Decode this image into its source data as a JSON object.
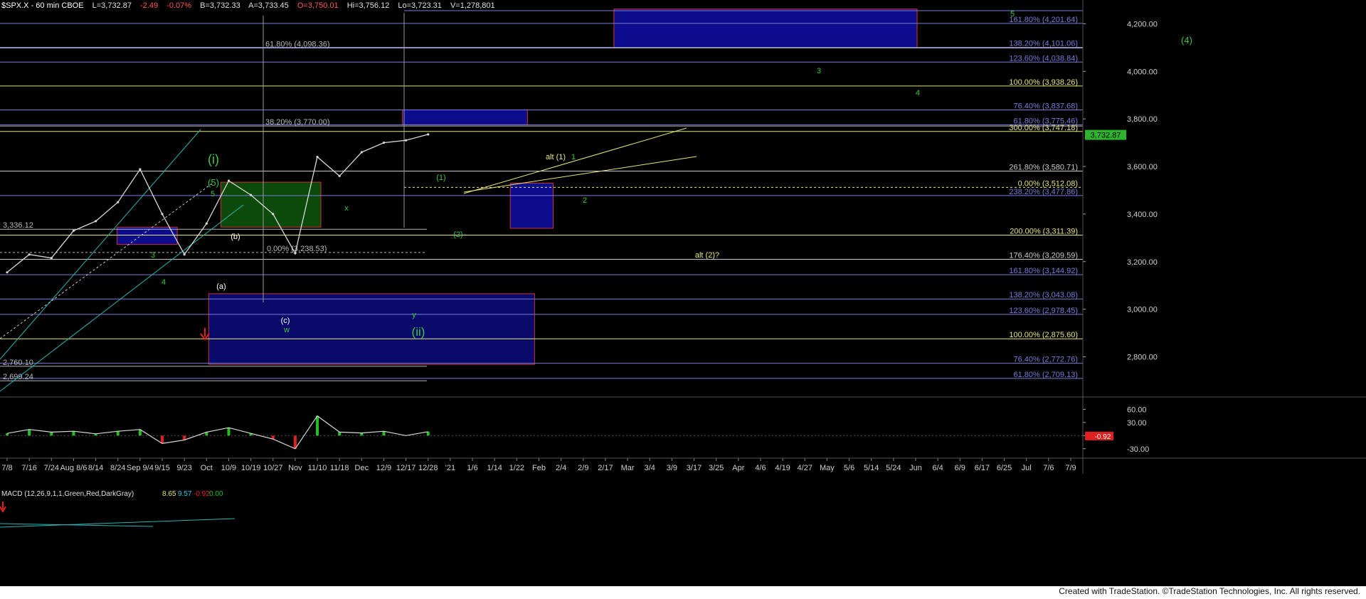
{
  "header": {
    "symbol": "$SPX.X - 60 min  CBOE",
    "last": "L=3,732.87",
    "change": "-2.49",
    "change_pct": "-0.07%",
    "bid": "B=3,732.33",
    "ask": "A=3,733.45",
    "open": "O=3,750.01",
    "high": "Hi=3,756.12",
    "low": "Lo=3,723.31",
    "volume": "V=1,278,801"
  },
  "price_scale": {
    "ticks": [
      {
        "v": 4200,
        "label": "4,200.00"
      },
      {
        "v": 4000,
        "label": "4,000.00"
      },
      {
        "v": 3800,
        "label": "3,800.00"
      },
      {
        "v": 3600,
        "label": "3,600.00"
      },
      {
        "v": 3400,
        "label": "3,400.00"
      },
      {
        "v": 3200,
        "label": "3,200.00"
      },
      {
        "v": 3000,
        "label": "3,000.00"
      },
      {
        "v": 2800,
        "label": "2,800.00"
      }
    ],
    "last_price": "3,732.87",
    "last_color": "#2db32d"
  },
  "macd_scale": {
    "ticks": [
      {
        "v": 60,
        "label": "60.00"
      },
      {
        "v": 30,
        "label": "30.00"
      },
      {
        "v": 0,
        "label": ""
      },
      {
        "v": -30,
        "label": "-30.00"
      }
    ],
    "last": "-0.92",
    "last_color": "#e02020"
  },
  "macd_legend": {
    "name": "MACD (12,26,9,1,1,Green,Red,DarkGray)",
    "values": [
      "8.65",
      "9.57",
      "-0.92",
      "0.00"
    ]
  },
  "time_axis": [
    "7/8",
    "7/16",
    "7/24",
    "Aug 8/6",
    "8/14",
    "8/24",
    "Sep 9/4",
    "9/15",
    "9/23",
    "Oct",
    "10/9",
    "10/19",
    "10/27",
    "Nov",
    "11/10",
    "11/18",
    "Dec",
    "12/9",
    "12/17",
    "12/28",
    "'21",
    "1/6",
    "1/14",
    "1/22",
    "Feb",
    "2/4",
    "2/9",
    "2/17",
    "Mar",
    "3/4",
    "3/9",
    "3/17",
    "3/25",
    "Apr",
    "4/6",
    "4/19",
    "4/27",
    "May",
    "5/6",
    "5/14",
    "5/24",
    "Jun",
    "6/4",
    "6/9",
    "6/17",
    "6/25",
    "Jul",
    "7/6",
    "7/9"
  ],
  "fib_levels": [
    {
      "text": "161.80% (4,201.64)",
      "v": 4201.64,
      "color": "#7b7bd8"
    },
    {
      "text": "138.20% (4,101.06)",
      "v": 4101.06,
      "color": "#7b7bd8"
    },
    {
      "text": "123.60% (4,038.84)",
      "v": 4038.84,
      "color": "#7b7bd8"
    },
    {
      "text": "100.00% (3,938.26)",
      "v": 3938.26,
      "color": "#e6e67a"
    },
    {
      "text": "76.40% (3,837.68)",
      "v": 3837.68,
      "color": "#7b7bd8"
    },
    {
      "text": "61.80% (3,775.46)",
      "v": 3775.46,
      "color": "#7b7bd8"
    },
    {
      "text": "300.00% (3,747.18)",
      "v": 3747.18,
      "color": "#e6e67a"
    },
    {
      "text": "261.80% (3,580.71)",
      "v": 3580.71,
      "color": "#c9c9c9"
    },
    {
      "text": "0.00% (3,512.08)",
      "v": 3512.08,
      "color": "#e6e67a"
    },
    {
      "text": "238.20% (3,477.86)",
      "v": 3477.86,
      "color": "#7b7bd8"
    },
    {
      "text": "200.00% (3,311.39)",
      "v": 3311.39,
      "color": "#e6e67a"
    },
    {
      "text": "176.40% (3,209.59)",
      "v": 3209.59,
      "color": "#c9c9c9"
    },
    {
      "text": "161.80% (3,144.92)",
      "v": 3144.92,
      "color": "#7b7bd8"
    },
    {
      "text": "138.20% (3,043.08)",
      "v": 3043.08,
      "color": "#7b7bd8"
    },
    {
      "text": "123.60% (2,978.45)",
      "v": 2978.45,
      "color": "#7b7bd8"
    },
    {
      "text": "100.00% (2,875.60)",
      "v": 2875.6,
      "color": "#e6e67a"
    },
    {
      "text": "76.40% (2,772.76)",
      "v": 2772.76,
      "color": "#7b7bd8"
    },
    {
      "text": "61.80% (2,709.13)",
      "v": 2709.13,
      "color": "#7b7bd8"
    }
  ],
  "left_levels": [
    {
      "text": "61.80% (4,098.36)",
      "v": 4098.36
    },
    {
      "text": "38.20% (3,770.00)",
      "v": 3770.0
    },
    {
      "text": "3,336.12",
      "v": 3336.12
    },
    {
      "text": "0.00% (3,238.53)",
      "v": 3238.53
    },
    {
      "text": "2,760.10",
      "v": 2760.1
    },
    {
      "text": "2,699.24",
      "v": 2699.24
    }
  ],
  "wave_labels": [
    {
      "text": "(i)",
      "color": "#3cc83c"
    },
    {
      "text": "(5)",
      "color": "#3cc83c"
    },
    {
      "text": "5",
      "color": "#3cc83c"
    },
    {
      "text": "3",
      "color": "#3cc83c"
    },
    {
      "text": "4",
      "color": "#3cc83c"
    },
    {
      "text": "(b)",
      "color": "#ffffff"
    },
    {
      "text": "(a)",
      "color": "#ffffff"
    },
    {
      "text": "(c)",
      "color": "#ffffff"
    },
    {
      "text": "w",
      "color": "#3cc83c"
    },
    {
      "text": "x",
      "color": "#3cc83c"
    },
    {
      "text": "y",
      "color": "#3cc83c"
    },
    {
      "text": "(ii)",
      "color": "#3cc83c"
    },
    {
      "text": "(1)",
      "color": "#3cc83c"
    },
    {
      "text": "(2)",
      "color": "#3cc83c"
    },
    {
      "text": "alt (1)",
      "color": "#e6e67a"
    },
    {
      "text": "1",
      "color": "#3cc83c"
    },
    {
      "text": "2",
      "color": "#3cc83c"
    },
    {
      "text": "alt (2)?",
      "color": "#e6e67a"
    },
    {
      "text": "3",
      "color": "#3cc83c"
    },
    {
      "text": "4",
      "color": "#3cc83c"
    },
    {
      "text": "5",
      "color": "#3cc83c"
    },
    {
      "text": "(4)",
      "color": "#3cc83c"
    }
  ],
  "chart_data": {
    "type": "line",
    "title": "$SPX.X - 60 min",
    "y_range": [
      2640,
      4270
    ],
    "price_path": [
      {
        "x": "7/8",
        "y": 3155
      },
      {
        "x": "7/16",
        "y": 3230
      },
      {
        "x": "7/24",
        "y": 3215
      },
      {
        "x": "Aug 8/6",
        "y": 3330
      },
      {
        "x": "8/14",
        "y": 3370
      },
      {
        "x": "8/24",
        "y": 3450
      },
      {
        "x": "Sep 9/4",
        "y": 3588
      },
      {
        "x": "9/15",
        "y": 3400
      },
      {
        "x": "9/23",
        "y": 3230
      },
      {
        "x": "Oct",
        "y": 3360
      },
      {
        "x": "10/9",
        "y": 3540
      },
      {
        "x": "10/19",
        "y": 3480
      },
      {
        "x": "10/27",
        "y": 3400
      },
      {
        "x": "Nov",
        "y": 3235
      },
      {
        "x": "11/10",
        "y": 3640
      },
      {
        "x": "11/18",
        "y": 3560
      },
      {
        "x": "Dec",
        "y": 3660
      },
      {
        "x": "12/9",
        "y": 3700
      },
      {
        "x": "12/17",
        "y": 3710
      },
      {
        "x": "12/28",
        "y": 3735
      }
    ],
    "macd_path": [
      {
        "x": "7/8",
        "y": 5
      },
      {
        "x": "7/16",
        "y": 14
      },
      {
        "x": "7/24",
        "y": 8
      },
      {
        "x": "Aug 8/6",
        "y": 10
      },
      {
        "x": "8/14",
        "y": 4
      },
      {
        "x": "8/24",
        "y": 10
      },
      {
        "x": "Sep 9/4",
        "y": 14
      },
      {
        "x": "9/15",
        "y": -18
      },
      {
        "x": "9/23",
        "y": -10
      },
      {
        "x": "Oct",
        "y": 8
      },
      {
        "x": "10/9",
        "y": 18
      },
      {
        "x": "10/19",
        "y": 5
      },
      {
        "x": "10/27",
        "y": -8
      },
      {
        "x": "Nov",
        "y": -30
      },
      {
        "x": "11/10",
        "y": 45
      },
      {
        "x": "11/18",
        "y": 8
      },
      {
        "x": "Dec",
        "y": 6
      },
      {
        "x": "12/9",
        "y": 10
      },
      {
        "x": "12/17",
        "y": 0
      },
      {
        "x": "12/28",
        "y": 9
      }
    ],
    "macd_range": [
      -45,
      72
    ]
  },
  "footer": "Created with TradeStation. ©TradeStation Technologies, Inc. All rights reserved."
}
